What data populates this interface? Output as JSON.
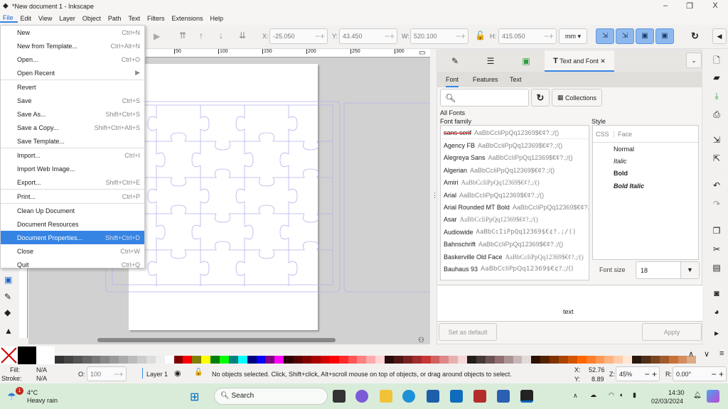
{
  "window": {
    "title": "*New document 1 - Inkscape",
    "minimize": "–",
    "restore": "❐",
    "close": "X"
  },
  "menubar": [
    "File",
    "Edit",
    "View",
    "Layer",
    "Object",
    "Path",
    "Text",
    "Filters",
    "Extensions",
    "Help"
  ],
  "toolbar": {
    "x_label": "X:",
    "x": "-25.050",
    "y_label": "Y:",
    "y": "43.450",
    "w_label": "W:",
    "w": "520.100",
    "h_label": "H:",
    "h": "415.050",
    "unit": "mm ▾"
  },
  "ruler_ticks": [
    "50",
    "100",
    "150",
    "200",
    "250",
    "300"
  ],
  "file_menu": [
    {
      "label": "New",
      "shortcut": "Ctrl+N"
    },
    {
      "label": "New from Template...",
      "shortcut": "Ctrl+Alt+N"
    },
    {
      "label": "Open...",
      "shortcut": "Ctrl+O"
    },
    {
      "label": "Open Recent",
      "shortcut": "▶",
      "sep_after": true
    },
    {
      "label": "Revert",
      "shortcut": ""
    },
    {
      "label": "Save",
      "shortcut": "Ctrl+S"
    },
    {
      "label": "Save As...",
      "shortcut": "Shift+Ctrl+S"
    },
    {
      "label": "Save a Copy...",
      "shortcut": "Shift+Ctrl+Alt+S"
    },
    {
      "label": "Save Template...",
      "shortcut": "",
      "sep_after": true
    },
    {
      "label": "Import...",
      "shortcut": "Ctrl+I"
    },
    {
      "label": "Import Web Image...",
      "shortcut": ""
    },
    {
      "label": "Export...",
      "shortcut": "Shift+Ctrl+E",
      "sep_after": true
    },
    {
      "label": "Print...",
      "shortcut": "Ctrl+P",
      "sep_after": true
    },
    {
      "label": "Clean Up Document",
      "shortcut": ""
    },
    {
      "label": "Document Resources",
      "shortcut": ""
    },
    {
      "label": "Document Properties...",
      "shortcut": "Shift+Ctrl+D",
      "selected": true
    },
    {
      "label": "Close",
      "shortcut": "Ctrl+W"
    },
    {
      "label": "Quit",
      "shortcut": "Ctrl+Q"
    }
  ],
  "dock": {
    "active_tab": "Text and Font",
    "tab_close": "✕",
    "subtabs": [
      "Font",
      "Features",
      "Text"
    ],
    "collections": "Collections",
    "all_fonts": "All Fonts",
    "font_family_label": "Font family",
    "style_label": "Style",
    "style_cols": [
      "CSS",
      "Face"
    ],
    "faces": [
      "Normal",
      "Italic",
      "Bold",
      "Bold Italic"
    ],
    "font_size_label": "Font size",
    "font_size": "18",
    "preview": "text",
    "set_default": "Set as default",
    "apply": "Apply",
    "sample": "AaBbCcIiPpQq12369$€¢?.;/()",
    "fonts": [
      "sans-serif",
      "Agency FB",
      "Alegreya Sans",
      "Algerian",
      "Amiri",
      "Arial",
      "Arial Rounded MT Bold",
      "Asar",
      "Audiowide",
      "Bahnschrift",
      "Baskerville Old Face",
      "Bauhaus 93"
    ]
  },
  "palette": [
    "#333333",
    "#444444",
    "#555555",
    "#666666",
    "#777777",
    "#888888",
    "#999999",
    "#aaaaaa",
    "#bbbbbb",
    "#cccccc",
    "#dddddd",
    "#eeeeee",
    "#ffffff",
    "#800000",
    "#ff0000",
    "#808000",
    "#ffff00",
    "#008000",
    "#00ff00",
    "#008080",
    "#00ffff",
    "#000080",
    "#0000ff",
    "#800080",
    "#ff00ff",
    "#2b0000",
    "#550000",
    "#800000",
    "#aa0000",
    "#d40000",
    "#ff0000",
    "#ff2a2a",
    "#ff5555",
    "#ff8080",
    "#ffaaaa",
    "#ffd5d5",
    "#280b0b",
    "#501616",
    "#782121",
    "#a02c2c",
    "#c83737",
    "#d35f5f",
    "#de8787",
    "#e9afaf",
    "#f4d7d7",
    "#241c1c",
    "#483737",
    "#6c5353",
    "#916f6f",
    "#ac9393",
    "#c8b7b7",
    "#e3dbdb",
    "#2b1100",
    "#552200",
    "#803300",
    "#aa4400",
    "#d45500",
    "#ff6600",
    "#ff7f2a",
    "#ff9955",
    "#ffb380",
    "#ffccaa",
    "#ffe6d5",
    "#28170b",
    "#502d16",
    "#784421",
    "#a05a2c",
    "#c87137",
    "#d38d5f",
    "#deaa87"
  ],
  "status": {
    "fill_label": "Fill:",
    "fill": "N/A",
    "stroke_label": "Stroke:",
    "stroke": "N/A",
    "o_label": "O:",
    "opacity": "100",
    "layer": "Layer 1",
    "message": "No objects selected. Click, Shift+click, Alt+scroll mouse on top of objects, or drag around objects to select.",
    "x_label": "X:",
    "x": "52.76",
    "y_label": "Y:",
    "y": "8.89",
    "z_label": "Z:",
    "zoom": "45%",
    "r_label": "R:",
    "rotation": "0.00°"
  },
  "taskbar": {
    "weather_temp": "4°C",
    "weather_desc": "Heavy rain",
    "weather_badge": "1",
    "search": "Search",
    "time": "14:30",
    "date": "02/03/2024"
  }
}
